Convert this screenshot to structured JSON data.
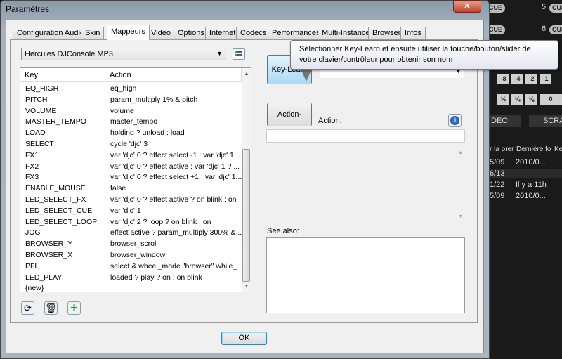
{
  "window": {
    "title": "Paramètres",
    "close": "✕"
  },
  "tabs": [
    "Configuration Audio",
    "Skin",
    "Mappeurs",
    "Video",
    "Options",
    "Internet",
    "Codecs",
    "Performances",
    "Multi-Instance",
    "Browser",
    "Infos"
  ],
  "active_tab": "Mappeurs",
  "mapper_select": "Hercules DJConsole MP3",
  "list": {
    "headers": {
      "key": "Key",
      "action": "Action"
    },
    "rows": [
      {
        "key": "EQ_HIGH",
        "action": "eq_high"
      },
      {
        "key": "PITCH",
        "action": "param_multiply 1% & pitch"
      },
      {
        "key": "VOLUME",
        "action": "volume"
      },
      {
        "key": "MASTER_TEMPO",
        "action": "master_tempo"
      },
      {
        "key": "LOAD",
        "action": "holding ? unload : load"
      },
      {
        "key": "SELECT",
        "action": "cycle 'djc' 3"
      },
      {
        "key": "FX1",
        "action": "var 'djc' 0 ? effect select -1 : var 'djc' 1 ..."
      },
      {
        "key": "FX2",
        "action": "var 'djc' 0 ? effect active : var 'djc' 1 ? ..."
      },
      {
        "key": "FX3",
        "action": "var 'djc' 0 ? effect select +1 : var 'djc' 1..."
      },
      {
        "key": "ENABLE_MOUSE",
        "action": "false"
      },
      {
        "key": "LED_SELECT_FX",
        "action": "var 'djc' 0 ? effect active ? on blink : on"
      },
      {
        "key": "LED_SELECT_CUE",
        "action": "var 'djc' 1"
      },
      {
        "key": "LED_SELECT_LOOP",
        "action": "var 'djc' 2 ? loop ? on blink : on"
      },
      {
        "key": "JOG",
        "action": "effect active ? param_multiply 300% & ..."
      },
      {
        "key": "BROWSER_Y",
        "action": "browser_scroll"
      },
      {
        "key": "BROWSER_X",
        "action": "browser_window"
      },
      {
        "key": "PFL",
        "action": "select & wheel_mode \"browser\" while_..."
      },
      {
        "key": "LED_PLAY",
        "action": "loaded ? play ? on : on blink"
      },
      {
        "key": "{new}",
        "action": ""
      }
    ]
  },
  "right": {
    "key_learn": "Key-Learn",
    "action_learn": "Action-Learn",
    "action_label": "Action:",
    "see_also": "See also:"
  },
  "tooltip": "Sélectionner Key-Learn et ensuite utiliser la touche/bouton/slider de votre clavier/contrôleur pour obtenir son nom",
  "ok": "OK",
  "background_app": {
    "cue": "CUE",
    "deck_nums": [
      "5",
      "6"
    ],
    "pitch_buttons": [
      "-8",
      "-4",
      "-2",
      "-1"
    ],
    "beat_buttons": [
      "½",
      "¼",
      "⅛",
      "0"
    ],
    "tabs": [
      "DEO",
      "SCRA"
    ],
    "columns": [
      "r la prer",
      "Dernière fo",
      "Ke"
    ],
    "rows": [
      [
        "5/09",
        "2010/0..."
      ],
      [
        "6/13",
        ""
      ],
      [
        "1/22",
        "Il y a 11h"
      ],
      [
        "5/09",
        "2010/0..."
      ]
    ]
  }
}
